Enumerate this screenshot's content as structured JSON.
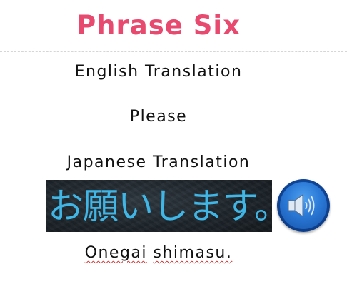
{
  "title": "Phrase Six",
  "english_heading": "English Translation",
  "english_text": "Please",
  "japanese_heading": "Japanese Translation",
  "japanese_text": "お願いします。",
  "romaji": {
    "word1": "Onegai",
    "word2": "shimasu."
  },
  "audio_button": {
    "icon": "speaker-icon"
  }
}
